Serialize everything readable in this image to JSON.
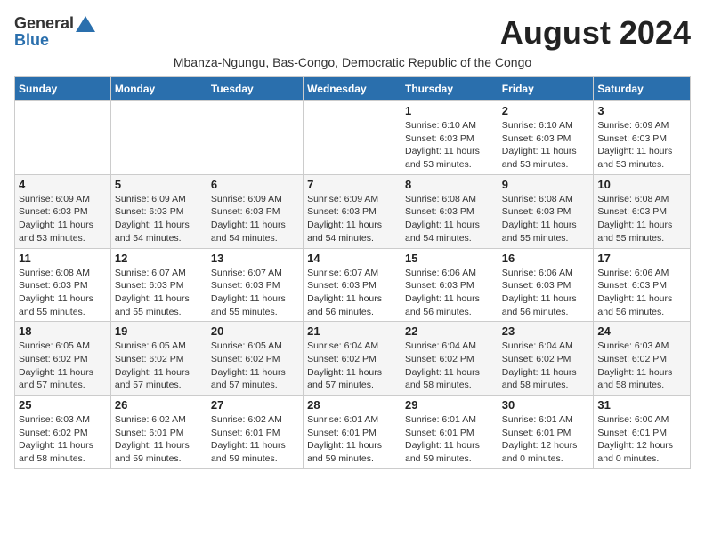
{
  "header": {
    "logo_general": "General",
    "logo_blue": "Blue",
    "month_year": "August 2024",
    "subtitle": "Mbanza-Ngungu, Bas-Congo, Democratic Republic of the Congo"
  },
  "weekdays": [
    "Sunday",
    "Monday",
    "Tuesday",
    "Wednesday",
    "Thursday",
    "Friday",
    "Saturday"
  ],
  "weeks": [
    [
      {
        "day": "",
        "info": ""
      },
      {
        "day": "",
        "info": ""
      },
      {
        "day": "",
        "info": ""
      },
      {
        "day": "",
        "info": ""
      },
      {
        "day": "1",
        "info": "Sunrise: 6:10 AM\nSunset: 6:03 PM\nDaylight: 11 hours\nand 53 minutes."
      },
      {
        "day": "2",
        "info": "Sunrise: 6:10 AM\nSunset: 6:03 PM\nDaylight: 11 hours\nand 53 minutes."
      },
      {
        "day": "3",
        "info": "Sunrise: 6:09 AM\nSunset: 6:03 PM\nDaylight: 11 hours\nand 53 minutes."
      }
    ],
    [
      {
        "day": "4",
        "info": "Sunrise: 6:09 AM\nSunset: 6:03 PM\nDaylight: 11 hours\nand 53 minutes."
      },
      {
        "day": "5",
        "info": "Sunrise: 6:09 AM\nSunset: 6:03 PM\nDaylight: 11 hours\nand 54 minutes."
      },
      {
        "day": "6",
        "info": "Sunrise: 6:09 AM\nSunset: 6:03 PM\nDaylight: 11 hours\nand 54 minutes."
      },
      {
        "day": "7",
        "info": "Sunrise: 6:09 AM\nSunset: 6:03 PM\nDaylight: 11 hours\nand 54 minutes."
      },
      {
        "day": "8",
        "info": "Sunrise: 6:08 AM\nSunset: 6:03 PM\nDaylight: 11 hours\nand 54 minutes."
      },
      {
        "day": "9",
        "info": "Sunrise: 6:08 AM\nSunset: 6:03 PM\nDaylight: 11 hours\nand 55 minutes."
      },
      {
        "day": "10",
        "info": "Sunrise: 6:08 AM\nSunset: 6:03 PM\nDaylight: 11 hours\nand 55 minutes."
      }
    ],
    [
      {
        "day": "11",
        "info": "Sunrise: 6:08 AM\nSunset: 6:03 PM\nDaylight: 11 hours\nand 55 minutes."
      },
      {
        "day": "12",
        "info": "Sunrise: 6:07 AM\nSunset: 6:03 PM\nDaylight: 11 hours\nand 55 minutes."
      },
      {
        "day": "13",
        "info": "Sunrise: 6:07 AM\nSunset: 6:03 PM\nDaylight: 11 hours\nand 55 minutes."
      },
      {
        "day": "14",
        "info": "Sunrise: 6:07 AM\nSunset: 6:03 PM\nDaylight: 11 hours\nand 56 minutes."
      },
      {
        "day": "15",
        "info": "Sunrise: 6:06 AM\nSunset: 6:03 PM\nDaylight: 11 hours\nand 56 minutes."
      },
      {
        "day": "16",
        "info": "Sunrise: 6:06 AM\nSunset: 6:03 PM\nDaylight: 11 hours\nand 56 minutes."
      },
      {
        "day": "17",
        "info": "Sunrise: 6:06 AM\nSunset: 6:03 PM\nDaylight: 11 hours\nand 56 minutes."
      }
    ],
    [
      {
        "day": "18",
        "info": "Sunrise: 6:05 AM\nSunset: 6:02 PM\nDaylight: 11 hours\nand 57 minutes."
      },
      {
        "day": "19",
        "info": "Sunrise: 6:05 AM\nSunset: 6:02 PM\nDaylight: 11 hours\nand 57 minutes."
      },
      {
        "day": "20",
        "info": "Sunrise: 6:05 AM\nSunset: 6:02 PM\nDaylight: 11 hours\nand 57 minutes."
      },
      {
        "day": "21",
        "info": "Sunrise: 6:04 AM\nSunset: 6:02 PM\nDaylight: 11 hours\nand 57 minutes."
      },
      {
        "day": "22",
        "info": "Sunrise: 6:04 AM\nSunset: 6:02 PM\nDaylight: 11 hours\nand 58 minutes."
      },
      {
        "day": "23",
        "info": "Sunrise: 6:04 AM\nSunset: 6:02 PM\nDaylight: 11 hours\nand 58 minutes."
      },
      {
        "day": "24",
        "info": "Sunrise: 6:03 AM\nSunset: 6:02 PM\nDaylight: 11 hours\nand 58 minutes."
      }
    ],
    [
      {
        "day": "25",
        "info": "Sunrise: 6:03 AM\nSunset: 6:02 PM\nDaylight: 11 hours\nand 58 minutes."
      },
      {
        "day": "26",
        "info": "Sunrise: 6:02 AM\nSunset: 6:01 PM\nDaylight: 11 hours\nand 59 minutes."
      },
      {
        "day": "27",
        "info": "Sunrise: 6:02 AM\nSunset: 6:01 PM\nDaylight: 11 hours\nand 59 minutes."
      },
      {
        "day": "28",
        "info": "Sunrise: 6:01 AM\nSunset: 6:01 PM\nDaylight: 11 hours\nand 59 minutes."
      },
      {
        "day": "29",
        "info": "Sunrise: 6:01 AM\nSunset: 6:01 PM\nDaylight: 11 hours\nand 59 minutes."
      },
      {
        "day": "30",
        "info": "Sunrise: 6:01 AM\nSunset: 6:01 PM\nDaylight: 12 hours\nand 0 minutes."
      },
      {
        "day": "31",
        "info": "Sunrise: 6:00 AM\nSunset: 6:01 PM\nDaylight: 12 hours\nand 0 minutes."
      }
    ]
  ]
}
